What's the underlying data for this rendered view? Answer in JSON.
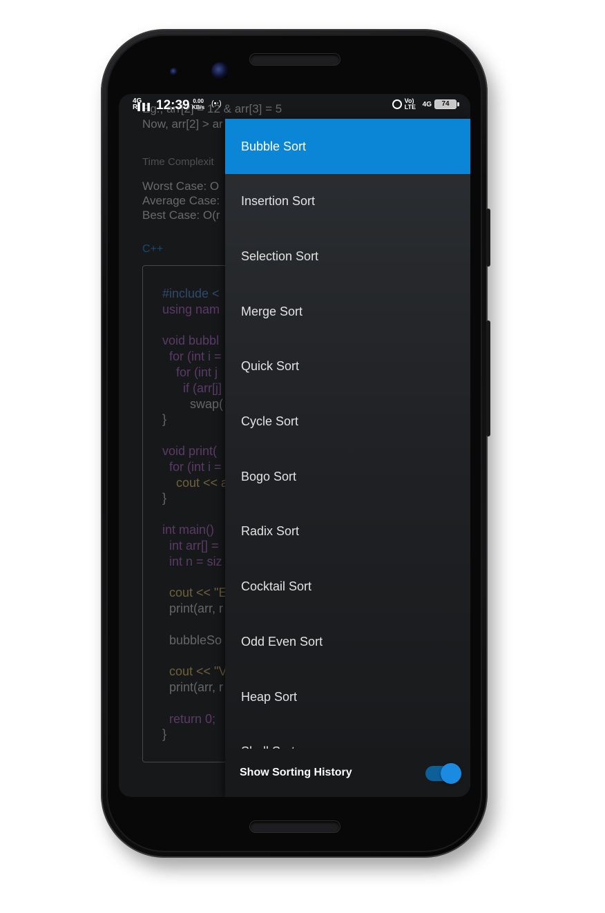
{
  "status_bar": {
    "network": "4G",
    "signal": "R▌▌▌",
    "time": "12:39",
    "speed_value": "0.00",
    "speed_unit": "KB/s",
    "hotspot_icon": "hotspot-icon",
    "alarm_icon": "alarm-icon",
    "volte": "Vo) LTE",
    "network_right": "4G",
    "battery": "74"
  },
  "background": {
    "example_line_1": "Eg., arr[2] = 12 & arr[3] = 5",
    "example_line_2": "Now, arr[2] > ar",
    "complexity_heading": "Time Complexit",
    "worst_case": "Worst Case: O",
    "average_case": "Average Case:",
    "best_case": "Best Case: O(r",
    "language": "C++",
    "code": [
      {
        "text": "#include <",
        "cls": "k-inc",
        "indent": 0
      },
      {
        "text": "using nam",
        "cls": "k-kw",
        "indent": 0
      },
      {
        "text": "",
        "cls": "k-plain",
        "indent": 0
      },
      {
        "text": "void bubbl",
        "cls": "k-kw",
        "indent": 0
      },
      {
        "text": "for (int i =",
        "cls": "k-kw",
        "indent": 1
      },
      {
        "text": "for (int j",
        "cls": "k-kw",
        "indent": 2
      },
      {
        "text": "if (arr[j]",
        "cls": "k-kw",
        "indent": 3
      },
      {
        "text": "swap(",
        "cls": "k-plain",
        "indent": 4
      },
      {
        "text": "}",
        "cls": "k-plain",
        "indent": 0
      },
      {
        "text": "",
        "cls": "k-plain",
        "indent": 0
      },
      {
        "text": "void print(",
        "cls": "k-kw",
        "indent": 0
      },
      {
        "text": "for (int i =",
        "cls": "k-kw",
        "indent": 1
      },
      {
        "text": "cout << a",
        "cls": "k-cout",
        "indent": 2
      },
      {
        "text": "}",
        "cls": "k-plain",
        "indent": 0
      },
      {
        "text": "",
        "cls": "k-plain",
        "indent": 0
      },
      {
        "text": "int main()",
        "cls": "k-kw",
        "indent": 0
      },
      {
        "text": "int arr[] =",
        "cls": "k-kw",
        "indent": 1
      },
      {
        "text": "int n = siz",
        "cls": "k-kw",
        "indent": 1
      },
      {
        "text": "",
        "cls": "k-plain",
        "indent": 0
      },
      {
        "text": "cout << \"E",
        "cls": "k-cout",
        "indent": 1
      },
      {
        "text": "print(arr, r",
        "cls": "k-plain",
        "indent": 1
      },
      {
        "text": "",
        "cls": "k-plain",
        "indent": 0
      },
      {
        "text": "bubbleSo",
        "cls": "k-plain",
        "indent": 1
      },
      {
        "text": "",
        "cls": "k-plain",
        "indent": 0
      },
      {
        "text": "cout << \"V",
        "cls": "k-cout",
        "indent": 1
      },
      {
        "text": "print(arr, r",
        "cls": "k-plain",
        "indent": 1
      },
      {
        "text": "",
        "cls": "k-plain",
        "indent": 0
      },
      {
        "text": "return 0;",
        "cls": "k-kw",
        "indent": 1
      },
      {
        "text": "}",
        "cls": "k-plain",
        "indent": 0
      }
    ]
  },
  "drawer": {
    "items": [
      {
        "label": "Bubble Sort",
        "active": true
      },
      {
        "label": "Insertion Sort",
        "active": false
      },
      {
        "label": "Selection Sort",
        "active": false
      },
      {
        "label": "Merge Sort",
        "active": false
      },
      {
        "label": "Quick Sort",
        "active": false
      },
      {
        "label": "Cycle Sort",
        "active": false
      },
      {
        "label": "Bogo Sort",
        "active": false
      },
      {
        "label": "Radix Sort",
        "active": false
      },
      {
        "label": "Cocktail Sort",
        "active": false
      },
      {
        "label": "Odd Even Sort",
        "active": false
      },
      {
        "label": "Heap Sort",
        "active": false
      },
      {
        "label": "Shell Sort",
        "active": false
      }
    ],
    "footer_label": "Show Sorting History",
    "toggle_on": true
  },
  "colors": {
    "accent": "#0b86d6",
    "drawer_bg": "#1f2124",
    "screen_bg": "#17181a"
  }
}
